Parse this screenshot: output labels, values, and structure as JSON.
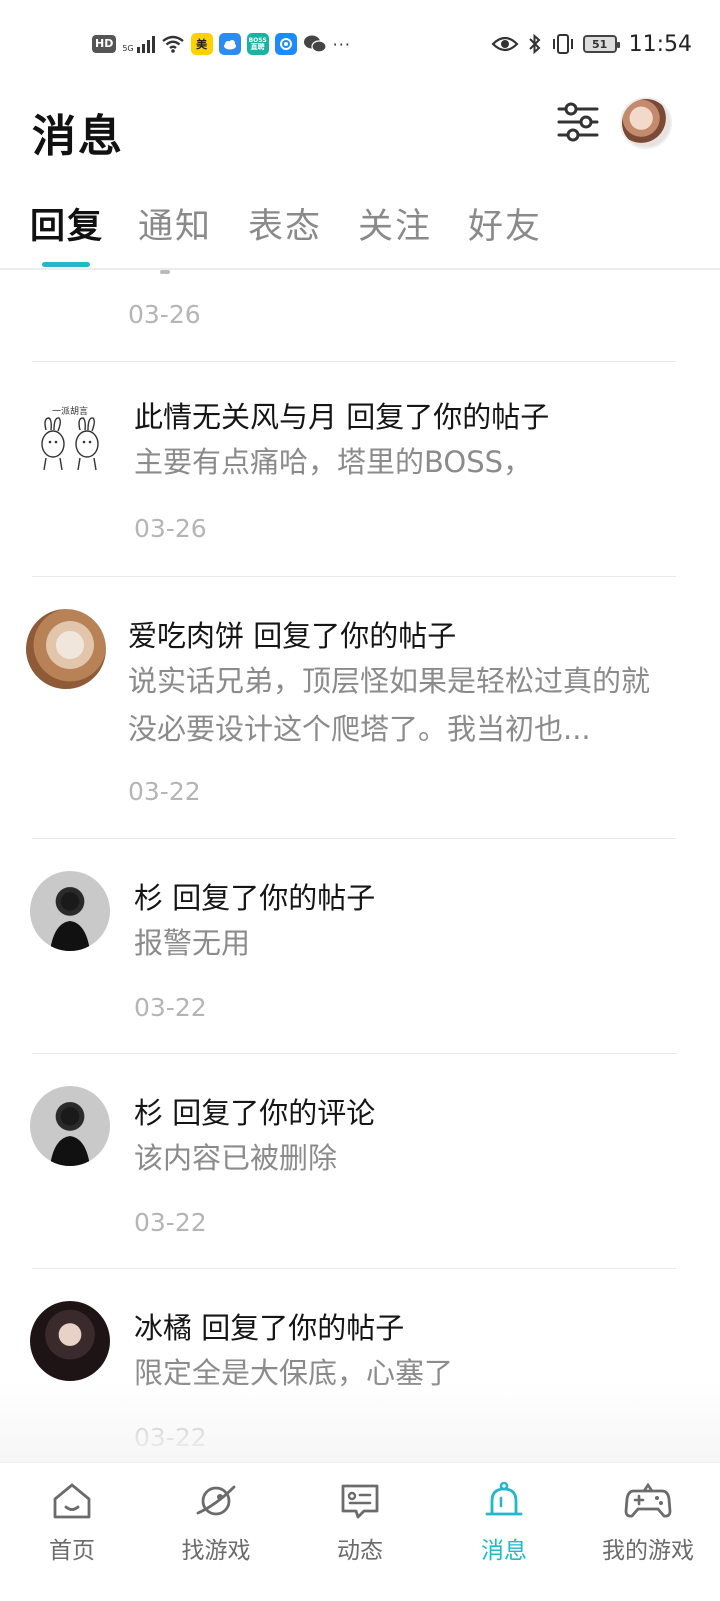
{
  "status_bar": {
    "network_badge": "HD",
    "signal_label": "5G",
    "app_meituan": "美",
    "app_boss": "BOSS",
    "more": "···",
    "battery": "51",
    "time": "11:54"
  },
  "header": {
    "title": "消息"
  },
  "tabs": [
    {
      "label": "回复",
      "active": true
    },
    {
      "label": "通知",
      "active": false
    },
    {
      "label": "表态",
      "active": false
    },
    {
      "label": "关注",
      "active": false
    },
    {
      "label": "好友",
      "active": false
    }
  ],
  "messages": [
    {
      "title": "",
      "body": "",
      "date": "03-26"
    },
    {
      "title": "此情无关风与月 回复了你的帖子",
      "body": "主要有点痛哈，塔里的BOSS，",
      "date": "03-26"
    },
    {
      "title": "爱吃肉饼 回复了你的帖子",
      "body": "说实话兄弟，顶层怪如果是轻松过真的就没必要设计这个爬塔了。我当初也...",
      "date": "03-22"
    },
    {
      "title": "杉 回复了你的帖子",
      "body": "报警无用",
      "date": "03-22"
    },
    {
      "title": "杉 回复了你的评论",
      "body": "该内容已被删除",
      "date": "03-22"
    },
    {
      "title": "冰橘 回复了你的帖子",
      "body": "限定全是大保底，心塞了",
      "date": "03-22"
    }
  ],
  "sticker_text": "一派胡言",
  "bottom_nav": [
    {
      "label": "首页",
      "icon": "home-icon"
    },
    {
      "label": "找游戏",
      "icon": "planet-icon"
    },
    {
      "label": "动态",
      "icon": "feed-icon"
    },
    {
      "label": "消息",
      "icon": "bell-icon",
      "active": true
    },
    {
      "label": "我的游戏",
      "icon": "gamepad-icon"
    }
  ],
  "colors": {
    "accent": "#22b8c8",
    "text_primary": "#151515",
    "text_secondary": "#8b8b8b",
    "date": "#b5b5b5"
  }
}
